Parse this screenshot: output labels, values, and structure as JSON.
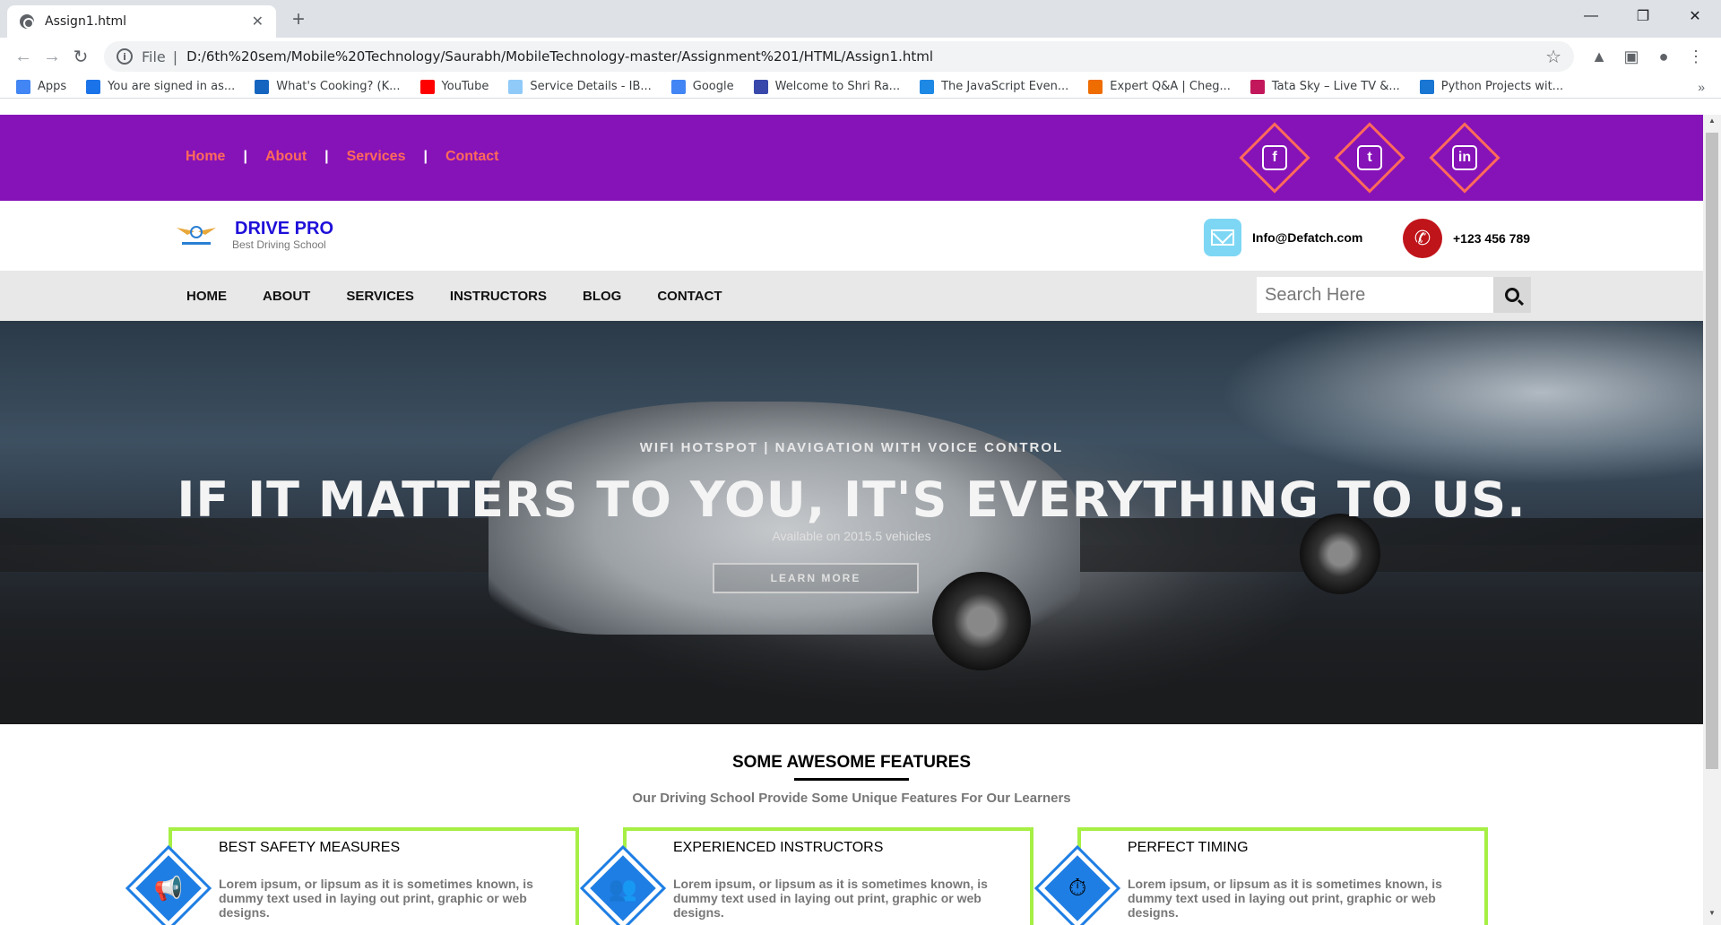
{
  "browser": {
    "tab_title": "Assign1.html",
    "tab_close": "✕",
    "new_tab": "+",
    "window_controls": [
      "—",
      "❐",
      "✕"
    ],
    "omnibox": {
      "scheme": "File",
      "separator": "|",
      "url": "D:/6th%20sem/Mobile%20Technology/Saurabh/MobileTechnology-master/Assignment%201/HTML/Assign1.html"
    },
    "bookmarks": [
      {
        "label": "Apps",
        "icon": "apps-grid-icon",
        "color": "#4285f4"
      },
      {
        "label": "You are signed in as...",
        "icon": "s-icon",
        "color": "#1a73e8"
      },
      {
        "label": "What's Cooking? (K...",
        "icon": "k-icon",
        "color": "#1565c0"
      },
      {
        "label": "YouTube",
        "icon": "youtube-icon",
        "color": "#ff0000"
      },
      {
        "label": "Service Details - IB...",
        "icon": "cloud-icon",
        "color": "#90caf9"
      },
      {
        "label": "Google",
        "icon": "google-icon",
        "color": "#4285f4"
      },
      {
        "label": "Welcome to Shri Ra...",
        "icon": "snowflake-icon",
        "color": "#3949ab"
      },
      {
        "label": "The JavaScript Even...",
        "icon": "f-icon",
        "color": "#1e88e5"
      },
      {
        "label": "Expert Q&A | Cheg...",
        "icon": "chegg-icon",
        "color": "#ef6c00"
      },
      {
        "label": "Tata Sky – Live TV &...",
        "icon": "tatasky-icon",
        "color": "#c2185b"
      },
      {
        "label": "Python Projects wit...",
        "icon": "python-icon",
        "color": "#1976d2"
      }
    ],
    "bookmarks_more": "»"
  },
  "topbar": {
    "nav": [
      "Home",
      "About",
      "Services",
      "Contact"
    ],
    "nav_separator": "|",
    "socials": [
      "facebook-icon",
      "twitter-icon",
      "linkedin-icon"
    ],
    "accent_color": "#ff6a5a",
    "background_color": "#8613b7"
  },
  "brand": {
    "name": "DRIVE PRO",
    "tagline": "Best Driving School",
    "email": "Info@Defatch.com",
    "phone": "+123 456 789"
  },
  "mainnav": {
    "items": [
      "HOME",
      "ABOUT",
      "SERVICES",
      "INSTRUCTORS",
      "BLOG",
      "CONTACT"
    ],
    "search_placeholder": "Search Here"
  },
  "hero": {
    "subtitle": "WIFI HOTSPOT | NAVIGATION WITH VOICE CONTROL",
    "title": "IF IT MATTERS TO YOU, IT'S EVERYTHING TO US.",
    "note": "Available on 2015.5 vehicles",
    "button": "LEARN MORE"
  },
  "features": {
    "title": "SOME AWESOME FEATURES",
    "subtitle": "Our Driving School Provide Some Unique Features For Our Learners",
    "cards": [
      {
        "title": "BEST SAFETY MEASURES",
        "text": "Lorem ipsum, or lipsum as it is sometimes known, is dummy text used in laying out print, graphic or web designs.",
        "icon": "megaphone-icon"
      },
      {
        "title": "EXPERIENCED INSTRUCTORS",
        "text": "Lorem ipsum, or lipsum as it is sometimes known, is dummy text used in laying out print, graphic or web designs.",
        "icon": "users-icon"
      },
      {
        "title": "PERFECT TIMING",
        "text": "Lorem ipsum, or lipsum as it is sometimes known, is dummy text used in laying out print, graphic or web designs.",
        "icon": "clock-icon"
      }
    ],
    "card_border_color": "#a6ef45",
    "icon_color": "#1e7ee4"
  }
}
